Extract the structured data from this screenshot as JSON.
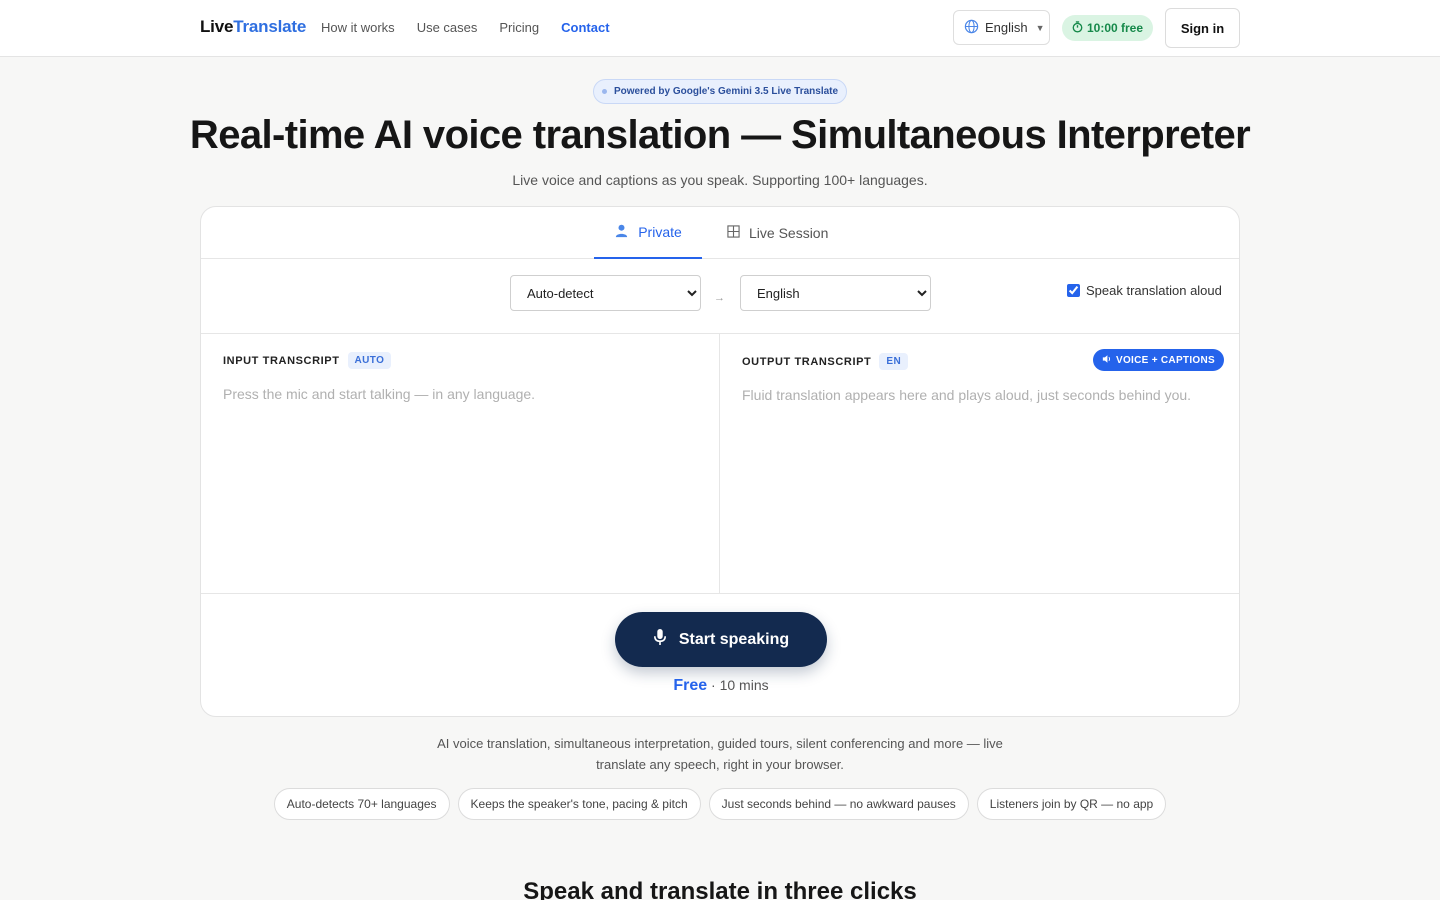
{
  "header": {
    "logo_part1": "Live",
    "logo_part2": "Translate",
    "nav": [
      {
        "label": "How it works"
      },
      {
        "label": "Use cases"
      },
      {
        "label": "Pricing"
      },
      {
        "label": "Contact"
      }
    ],
    "language": "English",
    "free_time": "10:00 free",
    "signin": "Sign in"
  },
  "hero": {
    "powered_by": "Powered by Google's Gemini 3.5 Live Translate",
    "title": "Real-time AI voice translation — Simultaneous Interpreter",
    "subtitle": "Live voice and captions as you speak. Supporting 100+ languages."
  },
  "card": {
    "tabs": [
      {
        "label": "Private",
        "icon": "person-icon"
      },
      {
        "label": "Live Session",
        "icon": "grid-icon"
      }
    ],
    "source_language": "Auto-detect",
    "target_language": "English",
    "arrow": "→",
    "speak_aloud_label": "Speak translation aloud",
    "speak_aloud_checked": true,
    "input": {
      "label": "INPUT TRANSCRIPT",
      "badge": "AUTO",
      "placeholder": "Press the mic and start talking — in any language."
    },
    "output": {
      "label": "OUTPUT TRANSCRIPT",
      "badge": "EN",
      "mode": "VOICE + CAPTIONS",
      "placeholder": "Fluid translation appears here and plays aloud, just seconds behind you."
    },
    "cta": "Start speaking",
    "free_label": "Free",
    "free_duration": "· 10 mins"
  },
  "description": "AI voice translation, simultaneous interpretation, guided tours, silent conferencing and more — live translate any speech, right in your browser.",
  "chips": [
    "Auto-detects 70+ languages",
    "Keeps the speaker's tone, pacing & pitch",
    "Just seconds behind — no awkward pauses",
    "Listeners join by QR — no app"
  ],
  "next_section_title": "Speak and translate in three clicks",
  "colors": {
    "accent": "#2563eb",
    "cta_bg": "#132a4f",
    "free_pill_bg": "#daf4e3",
    "free_pill_text": "#16894a"
  }
}
